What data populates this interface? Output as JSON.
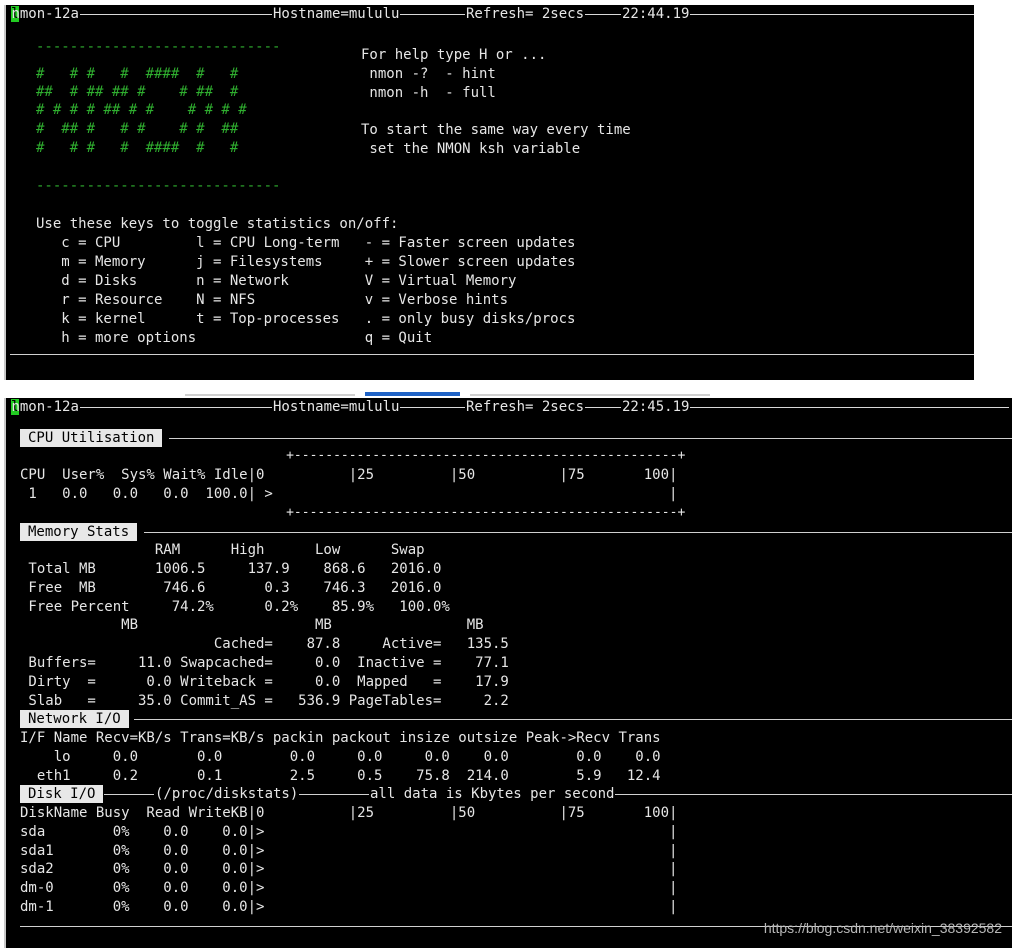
{
  "screen1": {
    "header": {
      "name": "nmon-12a",
      "hostname": "Hostname=mululu",
      "refresh": "Refresh= 2secs",
      "time": "22:44.19",
      "cursor_char": "l"
    },
    "logo_dashes": "-----------------------------",
    "logo_lines": [
      "#   # #   #  ####  #   #",
      "##  # ## ## #    # ##  #",
      "# # # # ## # #    # # # #",
      "#  ## #   # #    # #  ##",
      "#   # #   #  ####  #   #"
    ],
    "help_lines": [
      "For help type H or ...",
      " nmon -?  - hint",
      " nmon -h  - full",
      "",
      "To start the same way every time",
      " set the NMON ksh variable"
    ],
    "keys_title": "Use these keys to toggle statistics on/off:",
    "keys_rows": [
      "   c = CPU         l = CPU Long-term   - = Faster screen updates",
      "   m = Memory      j = Filesystems     + = Slower screen updates",
      "   d = Disks       n = Network         V = Virtual Memory",
      "   r = Resource    N = NFS             v = Verbose hints",
      "   k = kernel      t = Top-processes   . = only busy disks/procs",
      "   h = more options                    q = Quit"
    ]
  },
  "screen2": {
    "header": {
      "name": "nmon-12a",
      "hostname": "Hostname=mululu",
      "refresh": "Refresh= 2secs",
      "time": "22:45.19",
      "cursor_char": "l"
    },
    "cpu": {
      "title": "CPU Utilisation",
      "border_line": "                                  +-------------------------------------------------+",
      "header_line": "CPU  User%  Sys% Wait% Idle|0          |25         |50          |75       100|",
      "row_line": " 1   0.0   0.0   0.0  100.0| >                                               |",
      "rows": [
        {
          "cpu": "1",
          "user": "0.0",
          "sys": "0.0",
          "wait": "0.0",
          "idle": "100.0"
        }
      ]
    },
    "memory": {
      "title": "Memory Stats",
      "lines": [
        "                RAM      High      Low      Swap",
        " Total MB       1006.5     137.9    868.6   2016.0",
        " Free  MB        746.6       0.3    746.3   2016.0",
        " Free Percent     74.2%      0.2%    85.9%   100.0%",
        "            MB                     MB                MB",
        "                       Cached=    87.8     Active=   135.5",
        " Buffers=     11.0 Swapcached=     0.0  Inactive =    77.1",
        " Dirty  =      0.0 Writeback =     0.0  Mapped   =    17.9",
        " Slab   =     35.0 Commit_AS =   536.9 PageTables=     2.2"
      ]
    },
    "network": {
      "title": "Network I/O",
      "header_line": "I/F Name Recv=KB/s Trans=KB/s packin packout insize outsize Peak->Recv Trans",
      "rows": [
        "    lo     0.0       0.0        0.0     0.0     0.0    0.0        0.0    0.0",
        "  eth1     0.2       0.1        2.5     0.5    75.8  214.0        5.9   12.4"
      ]
    },
    "disk": {
      "title": "Disk I/O",
      "subtitle_a": "(/proc/diskstats)",
      "subtitle_b": "all data is Kbytes per second",
      "header_line": "DiskName Busy  Read WriteKB|0          |25         |50          |75       100|",
      "rows": [
        "sda        0%    0.0    0.0|>                                                |",
        "sda1       0%    0.0    0.0|>                                                |",
        "sda2       0%    0.0    0.0|>                                                |",
        "dm-0       0%    0.0    0.0|>                                                |",
        "dm-1       0%    0.0    0.0|>                                                |"
      ]
    },
    "watermark": "https://blog.csdn.net/weixin_38392582"
  }
}
